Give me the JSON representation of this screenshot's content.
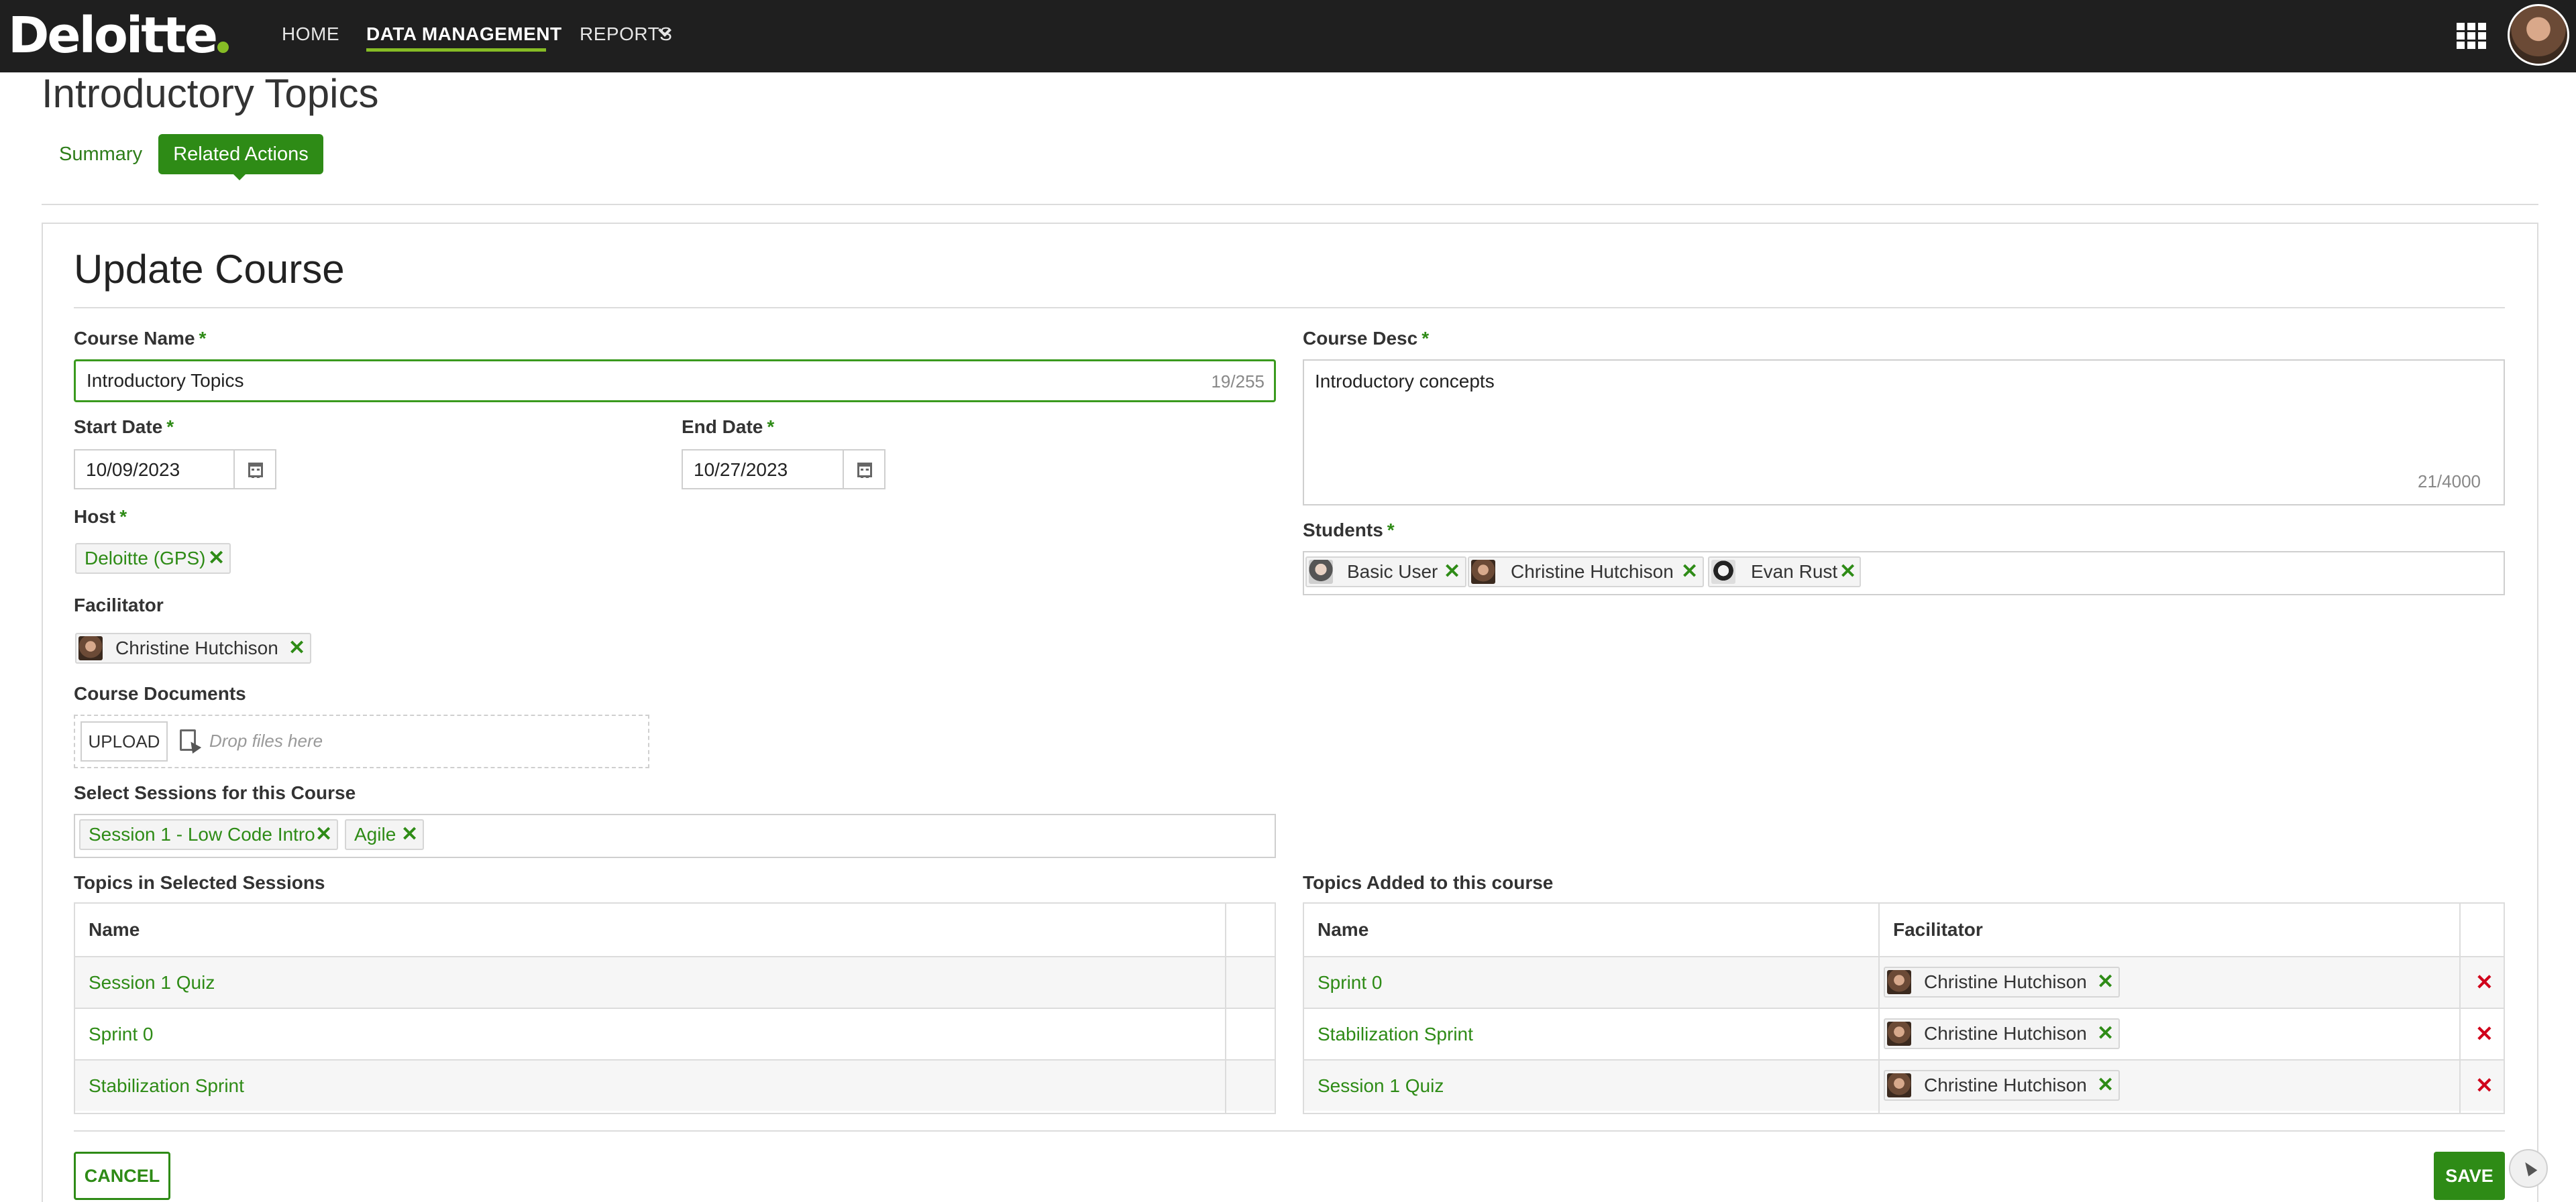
{
  "nav": {
    "brand": "Deloitte",
    "links": [
      "HOME",
      "DATA MANAGEMENT",
      "REPORTS"
    ],
    "active": "DATA MANAGEMENT",
    "icons": [
      "apps-grid-icon",
      "user-avatar"
    ]
  },
  "page": {
    "title": "Introductory Topics",
    "tabs": [
      "Summary",
      "Related Actions"
    ],
    "active_tab": "Related Actions"
  },
  "form": {
    "title": "Update Course",
    "course_name": {
      "label": "Course Name",
      "value": "Introductory Topics",
      "counter": "19/255"
    },
    "course_desc": {
      "label": "Course Desc",
      "value": "Introductory concepts",
      "counter": "21/4000"
    },
    "start_date": {
      "label": "Start Date",
      "value": "10/09/2023"
    },
    "end_date": {
      "label": "End Date",
      "value": "10/27/2023"
    },
    "host": {
      "label": "Host",
      "chips": [
        "Deloitte (GPS)"
      ]
    },
    "facilitator": {
      "label": "Facilitator",
      "chips": [
        "Christine Hutchison"
      ]
    },
    "students": {
      "label": "Students",
      "chips": [
        "Basic User",
        "Christine Hutchison",
        "Evan Rust"
      ]
    },
    "documents": {
      "label": "Course Documents",
      "upload_label": "UPLOAD",
      "drop_text": "Drop files here"
    },
    "sessions": {
      "label": "Select Sessions for this Course",
      "chips": [
        "Session 1 - Low Code Intro",
        "Agile"
      ]
    },
    "topics_in_sessions": {
      "label": "Topics in Selected Sessions",
      "columns": [
        "Name"
      ],
      "rows": [
        "Session 1 Quiz",
        "Sprint 0",
        "Stabilization Sprint"
      ]
    },
    "topics_added": {
      "label": "Topics Added to this course",
      "columns": [
        "Name",
        "Facilitator"
      ],
      "rows": [
        {
          "name": "Sprint 0",
          "facilitator": "Christine Hutchison"
        },
        {
          "name": "Stabilization Sprint",
          "facilitator": "Christine Hutchison"
        },
        {
          "name": "Session 1 Quiz",
          "facilitator": "Christine Hutchison"
        }
      ]
    },
    "buttons": {
      "cancel": "CANCEL",
      "save": "SAVE"
    }
  },
  "colors": {
    "accent": "#2e8b16",
    "brand_dot": "#86bc25",
    "nav_bg": "#1f1f1f",
    "delete": "#d0021b"
  }
}
